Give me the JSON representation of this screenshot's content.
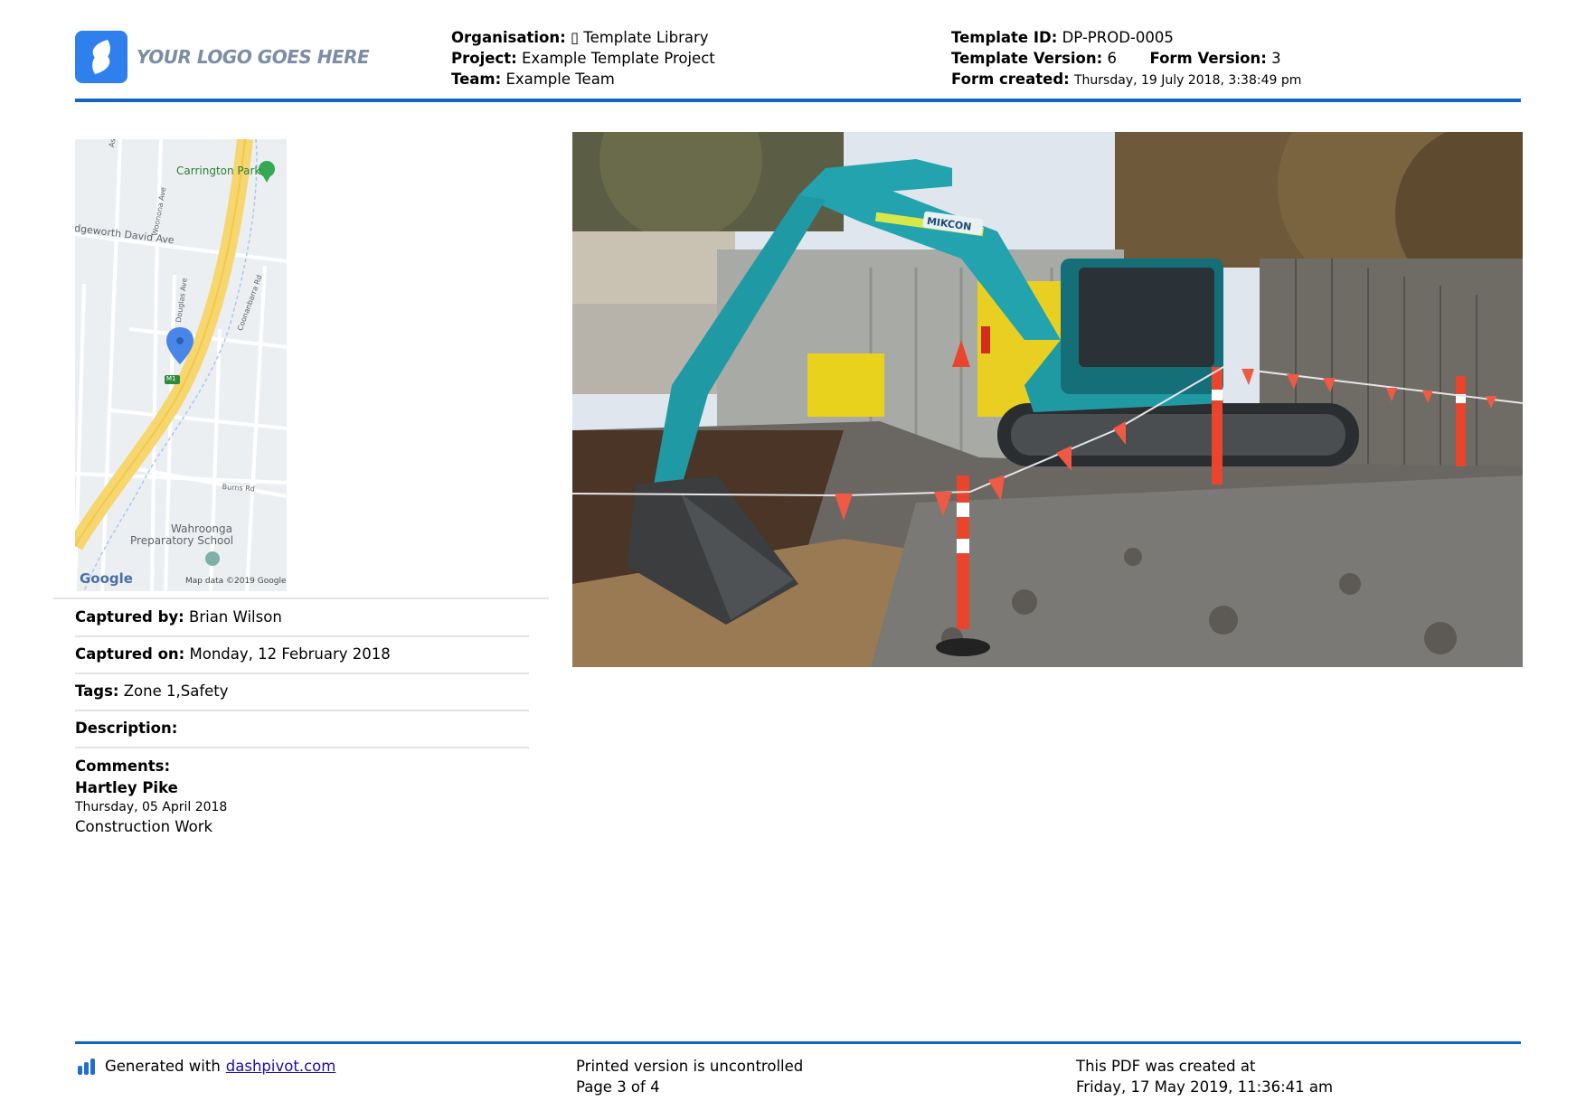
{
  "header": {
    "logo_text": "YOUR LOGO GOES HERE",
    "organisation_label": "Organisation:",
    "organisation_icon": "▯",
    "organisation_value": "Template Library",
    "project_label": "Project:",
    "project_value": "Example Template Project",
    "team_label": "Team:",
    "team_value": "Example Team",
    "template_id_label": "Template ID:",
    "template_id_value": "DP-PROD-0005",
    "template_version_label": "Template Version:",
    "template_version_value": "6",
    "form_version_label": "Form Version:",
    "form_version_value": "3",
    "form_created_label": "Form created:",
    "form_created_value": "Thursday, 19 July 2018, 3:38:49 pm"
  },
  "map": {
    "labels": {
      "carrington_park": "Carrington Park",
      "ascot_ave": "Ascot Ave",
      "woonona_ave": "Woonona Ave",
      "edgeworth": "dgeworth David Ave",
      "douglas_ave": "Douglas Ave",
      "coonanbarra": "Coonanbarra Rd",
      "m1": "M1",
      "burns_rd": "Burns Rd",
      "wahroonga_line1": "Wahroonga",
      "wahroonga_line2": "Preparatory School",
      "google": "Google",
      "map_data": "Map data ©2019 Google"
    }
  },
  "details": {
    "captured_by_label": "Captured by:",
    "captured_by_value": "Brian Wilson",
    "captured_on_label": "Captured on:",
    "captured_on_value": "Monday, 12 February 2018",
    "tags_label": "Tags:",
    "tags_value": "Zone 1,Safety",
    "description_label": "Description:",
    "description_value": "",
    "comments_label": "Comments:",
    "comment_author": "Hartley Pike",
    "comment_date": "Thursday, 05 April 2018",
    "comment_text": "Construction Work"
  },
  "photo": {
    "excavator_brand": "MIKCON"
  },
  "footer": {
    "generated_prefix": "Generated with",
    "generated_link": "dashpivot.com",
    "uncontrolled": "Printed version is uncontrolled",
    "page": "Page 3 of 4",
    "pdf_created_label": "This PDF was created at",
    "pdf_created_value": "Friday, 17 May 2019, 11:36:41 am"
  },
  "colors": {
    "accent": "#1565c0",
    "logo_blue": "#2f80ed",
    "link": "#1a0dab"
  }
}
